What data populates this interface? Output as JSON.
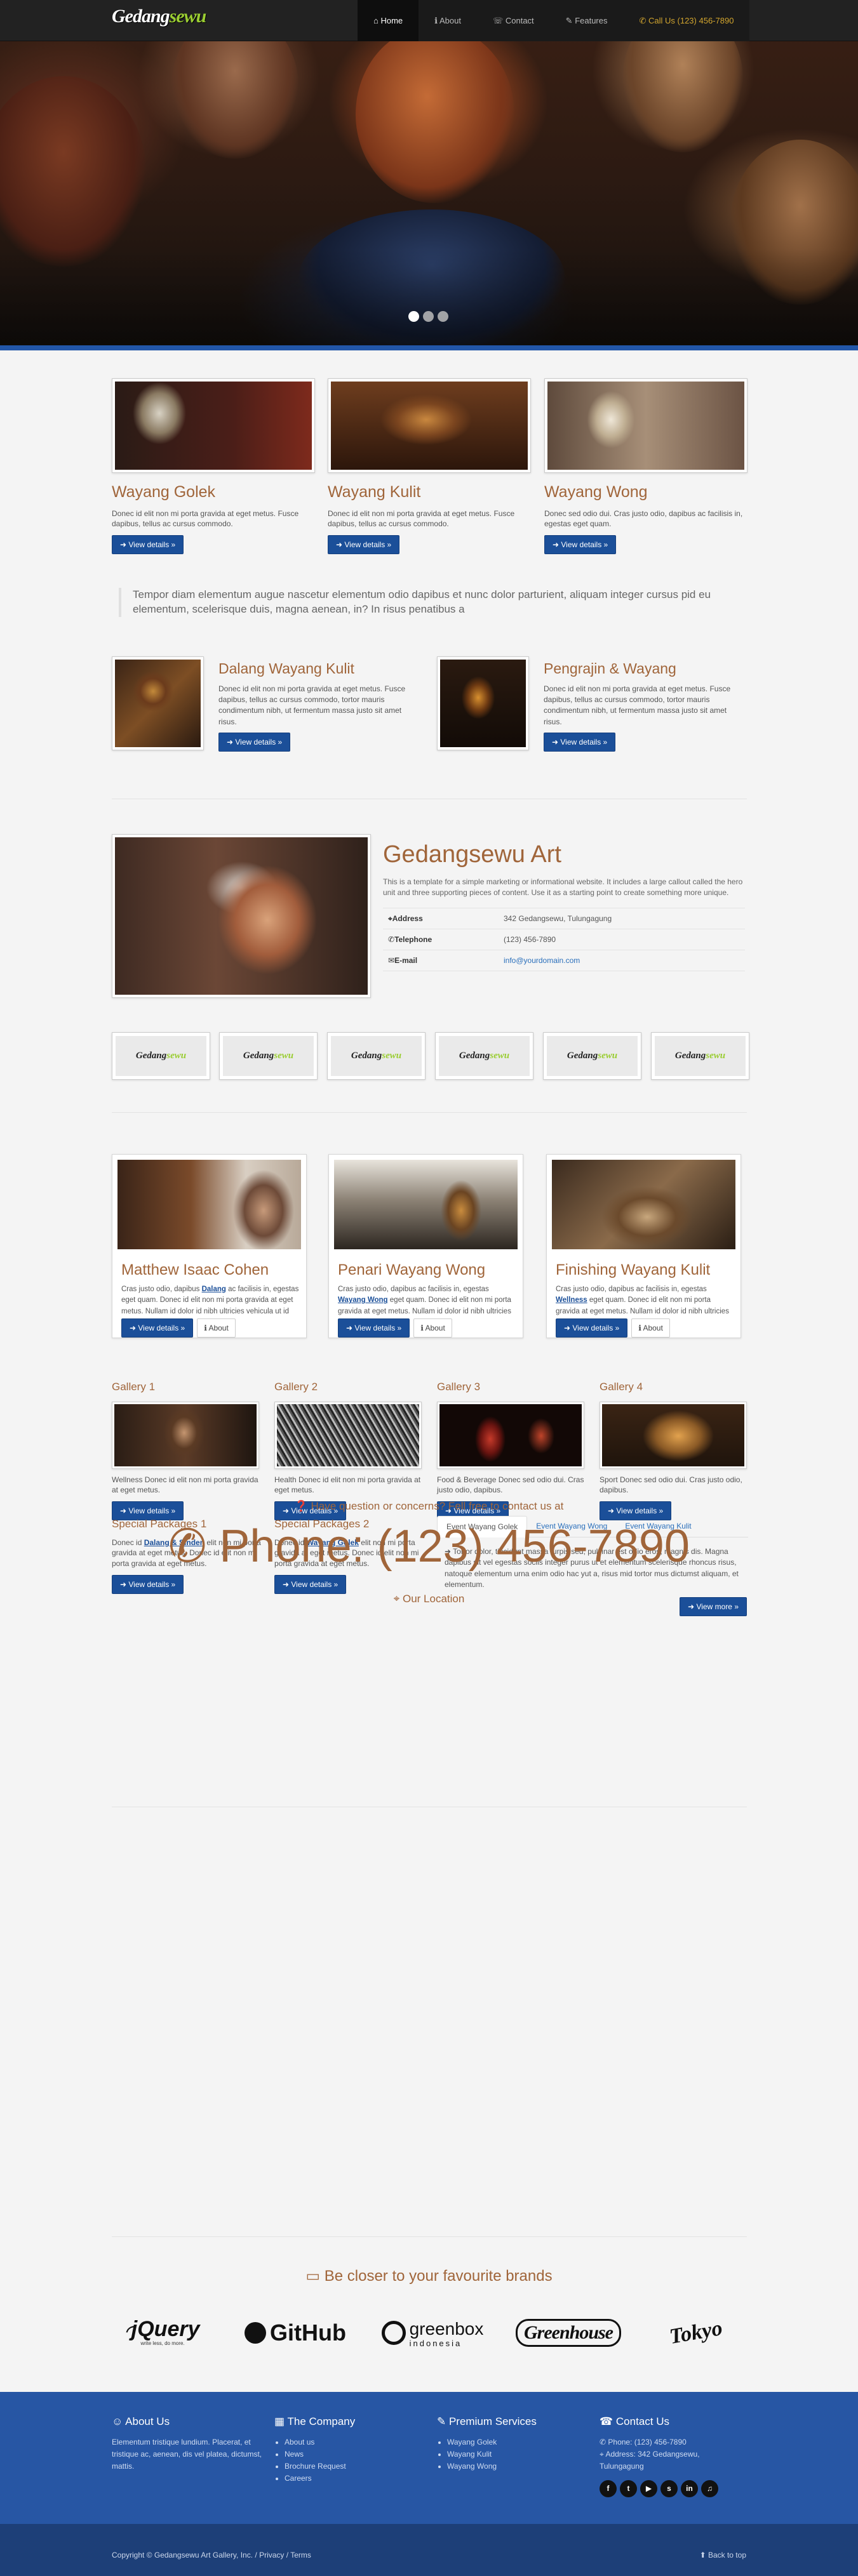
{
  "brand": {
    "logo_main": "Gedang",
    "logo_accent": "sewu"
  },
  "nav": {
    "items": [
      {
        "icon": "home-icon",
        "label": "Home",
        "active": true
      },
      {
        "icon": "info-icon",
        "label": "About"
      },
      {
        "icon": "contact-icon",
        "label": "Contact"
      },
      {
        "icon": "wrench-icon",
        "label": "Features"
      },
      {
        "icon": "phone-icon",
        "label": "Call Us (123) 456-7890"
      }
    ]
  },
  "hero": {
    "slides": 3,
    "active_slide": 1
  },
  "features": [
    {
      "title": "Wayang Golek",
      "text": "Donec id elit non mi porta gravida at eget metus. Fusce dapibus, tellus ac cursus commodo.",
      "button": "View details »"
    },
    {
      "title": "Wayang Kulit",
      "text": "Donec id elit non mi porta gravida at eget metus. Fusce dapibus, tellus ac cursus commodo.",
      "button": "View details »"
    },
    {
      "title": "Wayang Wong",
      "text": "Donec sed odio dui. Cras justo odio, dapibus ac facilisis in, egestas eget quam.",
      "button": "View details »"
    }
  ],
  "quote": "Tempor diam elementum augue nascetur elementum odio dapibus et nunc dolor parturient, aliquam integer cursus pid eu elementum, scelerisque duis, magna aenean, in? In risus penatibus a",
  "media": [
    {
      "title": "Dalang Wayang Kulit",
      "text": "Donec id elit non mi porta gravida at eget metus. Fusce dapibus, tellus ac cursus commodo, tortor mauris condimentum nibh, ut fermentum massa justo sit amet risus.",
      "button": "View details »"
    },
    {
      "title": "Pengrajin & Wayang",
      "text": "Donec id elit non mi porta gravida at eget metus. Fusce dapibus, tellus ac cursus commodo, tortor mauris condimentum nibh, ut fermentum massa justo sit amet risus.",
      "button": "View details »"
    }
  ],
  "about": {
    "title": "Gedangsewu Art",
    "text": "This is a template for a simple marketing or informational website. It includes a large callout called the hero unit and three supporting pieces of content. Use it as a starting point to create something more unique.",
    "rows": [
      {
        "label": "Address",
        "value": "342 Gedangsewu, Tulungagung"
      },
      {
        "label": "Telephone",
        "value": "(123) 456-7890"
      },
      {
        "label": "E-mail",
        "value": "info@yourdomain.com"
      }
    ]
  },
  "partner_logos": {
    "main": "Gedang",
    "accent": "sewu",
    "count": 6
  },
  "cards": [
    {
      "title": "Matthew Isaac Cohen",
      "pre": "Cras justo odio, dapibus ",
      "link": "Dalang",
      "post": " ac facilisis in, egestas eget quam. Donec id elit non mi porta gravida at eget metus. Nullam id dolor id nibh ultricies vehicula ut id elit.",
      "button": "View details »",
      "about": "About"
    },
    {
      "title": "Penari Wayang Wong",
      "pre": "Cras justo odio, dapibus ac facilisis in, egestas ",
      "link": "Wayang Wong",
      "post": " eget quam. Donec id elit non mi porta gravida at eget metus. Nullam id dolor id nibh ultricies vehicula ut id elit.",
      "button": "View details »",
      "about": "About"
    },
    {
      "title": "Finishing Wayang Kulit",
      "pre": "Cras justo odio, dapibus ac facilisis in, egestas ",
      "link": "Wellness",
      "post": " eget quam. Donec id elit non mi porta gravida at eget metus. Nullam id dolor id nibh ultricies vehicula ut id elit.",
      "button": "View details »",
      "about": "About"
    }
  ],
  "galleries": [
    {
      "title": "Gallery 1",
      "text": "Wellness Donec id elit non mi porta gravida at eget metus.",
      "button": "View details »"
    },
    {
      "title": "Gallery 2",
      "text": "Health Donec id elit non mi porta gravida at eget metus.",
      "button": "View details »"
    },
    {
      "title": "Gallery 3",
      "text": "Food & Beverage Donec sed odio dui. Cras justo odio, dapibus.",
      "button": "View details »"
    },
    {
      "title": "Gallery 4",
      "text": "Sport Donec sed odio dui. Cras justo odio, dapibus.",
      "button": "View details »"
    }
  ],
  "packages": [
    {
      "title": "Special Packages 1",
      "pre": "Donec id ",
      "link": "Dalang & Sinden",
      "post": " elit non mi porta gravida at eget metus. Donec id elit non mi porta gravida at eget metus.",
      "button": "View details »"
    },
    {
      "title": "Special Packages 2",
      "pre": "Donec id ",
      "link": "Wayang Golek",
      "post": " elit non mi porta gravida at eget metus. Donec id elit non mi porta gravida at eget metus.",
      "button": "View details »"
    }
  ],
  "tabs": {
    "labels": [
      "Event Wayang Golek",
      "Event Wayang Wong",
      "Event Wayang Kulit"
    ],
    "content": "Tortor dolor, tincidunt massa turpis sed, pulvinar est odio eros, magnis dis. Magna dapibus sit vel egestas sociis integer purus ut et elementum scelerisque rhoncus risus, natoque elementum urna enim odio hac yut a, risus mid tortor mus dictumst aliquam, et elementum.",
    "button": "View more »"
  },
  "contact": {
    "question": "Have question or concerns? Fell free to contact us at",
    "phone": "Phone: (123) 456-7890",
    "location": "Our Location"
  },
  "brands": {
    "title": "Be closer to your favourite brands",
    "items": [
      "jQuery",
      "GitHub",
      "greenbox",
      "Greenhouse",
      "Tokyo"
    ],
    "jquery_tag": "write less, do more.",
    "greenbox_sub": "indonesia"
  },
  "footer": {
    "about": {
      "title": "About Us",
      "text": "Elementum tristique lundium. Placerat, et tristique ac, aenean, dis vel platea, dictumst, mattis."
    },
    "company": {
      "title": "The Company",
      "items": [
        "About us",
        "News",
        "Brochure Request",
        "Careers"
      ]
    },
    "services": {
      "title": "Premium Services",
      "items": [
        "Wayang Golek",
        "Wayang Kulit",
        "Wayang Wong"
      ]
    },
    "contact": {
      "title": "Contact Us",
      "phone": "Phone: (123) 456-7890",
      "address": "Address: 342 Gedangsewu, Tulungagung"
    },
    "social": [
      "f",
      "t",
      "▶",
      "s",
      "in",
      "♫"
    ]
  },
  "bottom": {
    "copyright": "Copyright © Gedangsewu Art Gallery, Inc. / ",
    "privacy": "Privacy",
    "slash": " / ",
    "terms": "Terms",
    "back_to_top": "Back to top"
  },
  "colors": {
    "accent": "#a0653a",
    "primary": "#1b4f99",
    "footer": "#2756a4",
    "footer_bottom": "#1d3f78",
    "nav": "#222222"
  }
}
